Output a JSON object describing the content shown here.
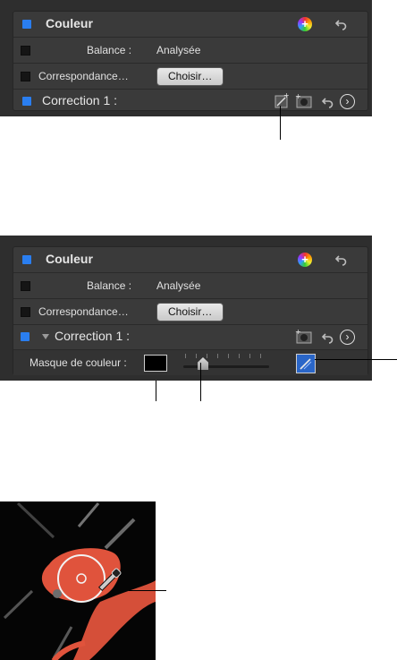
{
  "panel1": {
    "title": "Couleur",
    "balance_label": "Balance :",
    "balance_value": "Analysée",
    "match_label": "Correspondance…",
    "match_button": "Choisir…",
    "correction_title": "Correction 1 :"
  },
  "panel2": {
    "title": "Couleur",
    "balance_label": "Balance :",
    "balance_value": "Analysée",
    "match_label": "Correspondance…",
    "match_button": "Choisir…",
    "correction_title": "Correction 1 :",
    "mask_label": "Masque de couleur :",
    "mask_color": "#000000",
    "slider_value": 0.2
  },
  "colors": {
    "accent_blue": "#2a7ef0",
    "panel_bg": "#3a3a3a",
    "mask_red": "#e0533c"
  },
  "icons": [
    "plus-color-icon",
    "undo-icon",
    "chevron-right-icon",
    "mask-shape-icon",
    "magic-wand-icon",
    "disclosure-triangle-icon",
    "eyedropper-icon"
  ]
}
